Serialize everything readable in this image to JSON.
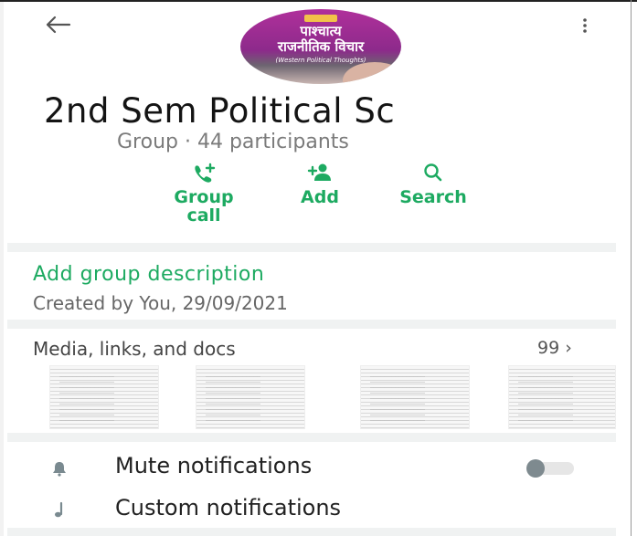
{
  "header": {
    "back_icon": "arrow-left-icon",
    "menu_icon": "more-vertical-icon",
    "avatar": {
      "title_line1": "पाश्चात्य",
      "title_line2": "राजनीतिक विचार",
      "subtitle": "(Western Political Thoughts)"
    },
    "group_name": "2nd Sem Political Sc",
    "group_meta": "Group · 44 participants"
  },
  "actions": [
    {
      "label_line1": "Group",
      "label_line2": "call",
      "icon": "add-call-icon"
    },
    {
      "label_line1": "Add",
      "label_line2": "",
      "icon": "add-person-icon"
    },
    {
      "label_line1": "Search",
      "label_line2": "",
      "icon": "search-icon"
    }
  ],
  "description": {
    "add_label": "Add group description",
    "created_by": "Created by You, 29/09/2021"
  },
  "media": {
    "title": "Media, links, and docs",
    "count": "99",
    "chevron": "›"
  },
  "settings": {
    "mute_label": "Mute notifications",
    "mute_on": false,
    "custom_label": "Custom notifications"
  },
  "colors": {
    "accent": "#1daa61",
    "muted_text": "#7b7b7b",
    "divider": "#f0f2f2"
  }
}
